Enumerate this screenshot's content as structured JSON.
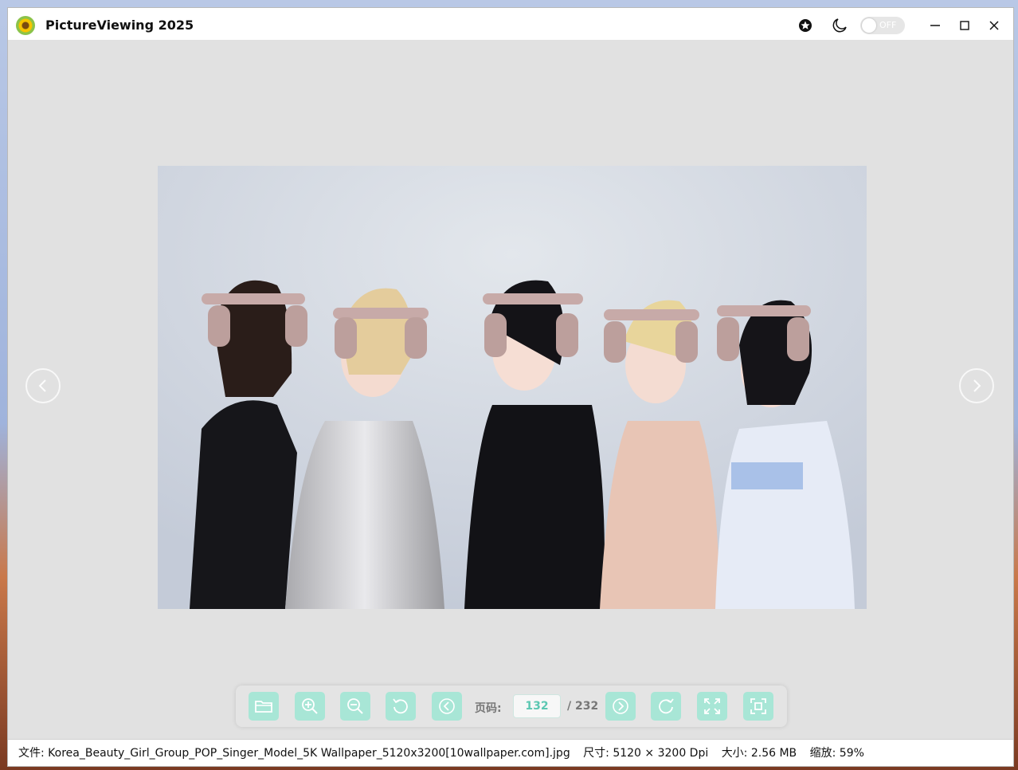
{
  "window": {
    "title": "PictureViewing 2025",
    "theme_toggle_label": "OFF",
    "icons": {
      "app": "sunflower-app-icon",
      "star": "star-icon",
      "moon": "moon-icon",
      "minimize": "minimize-icon",
      "maximize": "maximize-icon",
      "close": "close-icon"
    }
  },
  "viewer": {
    "image_subject": "five-women-with-headphones",
    "prev_icon": "chevron-left-icon",
    "next_icon": "chevron-right-icon"
  },
  "toolbar": {
    "page_label": "页码:",
    "page_value": "132",
    "page_total": "/ 232",
    "accent": "#a8e6d6",
    "buttons": [
      "open-folder-icon",
      "zoom-in-icon",
      "zoom-out-icon",
      "rotate-left-icon",
      "previous-icon",
      "next-icon",
      "rotate-right-icon",
      "fit-screen-icon",
      "actual-size-icon"
    ]
  },
  "status": {
    "file": "文件: Korea_Beauty_Girl_Group_POP_Singer_Model_5K Wallpaper_5120x3200[10wallpaper.com].jpg",
    "dimensions": "尺寸: 5120 × 3200 Dpi",
    "size": "大小: 2.56 MB",
    "zoom": "缩放: 59%"
  }
}
